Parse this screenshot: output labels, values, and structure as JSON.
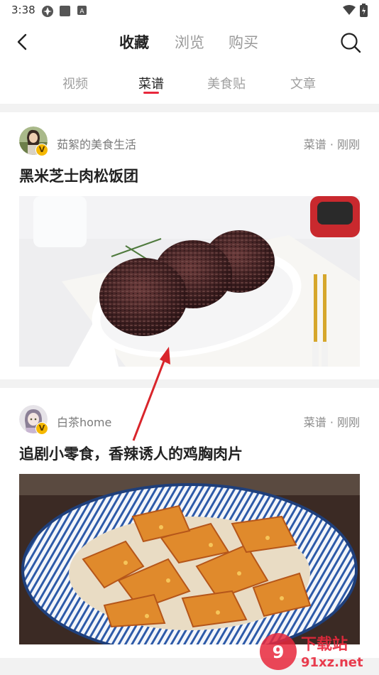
{
  "status_bar": {
    "time": "3:38"
  },
  "header": {
    "tabs": [
      {
        "label": "收藏",
        "active": true
      },
      {
        "label": "浏览",
        "active": false
      },
      {
        "label": "购买",
        "active": false
      }
    ]
  },
  "sub_tabs": [
    {
      "label": "视频",
      "active": false
    },
    {
      "label": "菜谱",
      "active": true
    },
    {
      "label": "美食贴",
      "active": false
    },
    {
      "label": "文章",
      "active": false
    }
  ],
  "cards": [
    {
      "author": "茹絮的美食生活",
      "meta": "菜谱 · 刚刚",
      "title": "黑米芝士肉松饭团",
      "badge": "V"
    },
    {
      "author": "白茶home",
      "meta": "菜谱 · 刚刚",
      "title": "追剧小零食，香辣诱人的鸡胸肉片",
      "badge": "V"
    }
  ],
  "watermark": {
    "line1": "下载站",
    "line2": "91xz.net"
  },
  "colors": {
    "accent": "#e8283c",
    "divider": "#f2f2f2",
    "badge": "#f5b800"
  }
}
